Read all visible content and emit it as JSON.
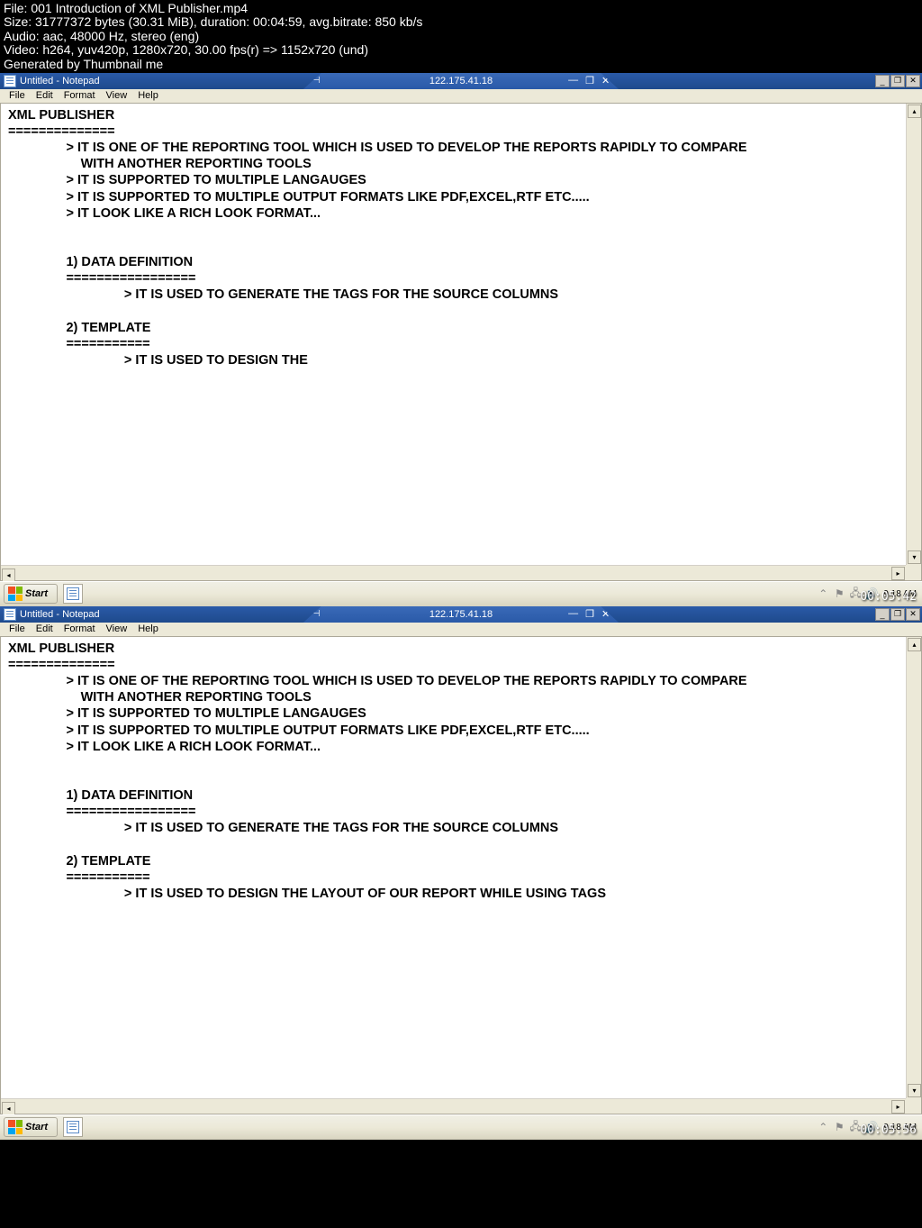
{
  "video_header": {
    "file": "File: 001 Introduction of XML Publisher.mp4",
    "size": "Size: 31777372 bytes (30.31 MiB), duration: 00:04:59, avg.bitrate: 850 kb/s",
    "audio": "Audio: aac, 48000 Hz, stereo (eng)",
    "video": "Video: h264, yuv420p, 1280x720, 30.00 fps(r) => 1152x720 (und)",
    "generated": "Generated by Thumbnail me"
  },
  "frame1": {
    "titlebar": {
      "title": "Untitled - Notepad",
      "remote_ip": "122.175.41.18"
    },
    "menu": [
      "File",
      "Edit",
      "Format",
      "View",
      "Help"
    ],
    "content": "XML PUBLISHER\n==============\n                > IT IS ONE OF THE REPORTING TOOL WHICH IS USED TO DEVELOP THE REPORTS RAPIDLY TO COMPARE\n                    WITH ANOTHER REPORTING TOOLS\n                > IT IS SUPPORTED TO MULTIPLE LANGAUGES\n                > IT IS SUPPORTED TO MULTIPLE OUTPUT FORMATS LIKE PDF,EXCEL,RTF ETC.....\n                > IT LOOK LIKE A RICH LOOK FORMAT...\n\n\n                1) DATA DEFINITION\n                =================\n                                > IT IS USED TO GENERATE THE TAGS FOR THE SOURCE COLUMNS\n\n                2) TEMPLATE\n                ===========\n                                > IT IS USED TO DESIGN THE",
    "taskbar": {
      "start": "Start",
      "clock_time": "9:18 AM"
    },
    "timestamp": "00:05:42"
  },
  "frame2": {
    "titlebar": {
      "title": "Untitled - Notepad",
      "remote_ip": "122.175.41.18"
    },
    "menu": [
      "File",
      "Edit",
      "Format",
      "View",
      "Help"
    ],
    "content": "XML PUBLISHER\n==============\n                > IT IS ONE OF THE REPORTING TOOL WHICH IS USED TO DEVELOP THE REPORTS RAPIDLY TO COMPARE\n                    WITH ANOTHER REPORTING TOOLS\n                > IT IS SUPPORTED TO MULTIPLE LANGAUGES\n                > IT IS SUPPORTED TO MULTIPLE OUTPUT FORMATS LIKE PDF,EXCEL,RTF ETC.....\n                > IT LOOK LIKE A RICH LOOK FORMAT...\n\n\n                1) DATA DEFINITION\n                =================\n                                > IT IS USED TO GENERATE THE TAGS FOR THE SOURCE COLUMNS\n\n                2) TEMPLATE\n                ===========\n                                > IT IS USED TO DESIGN THE LAYOUT OF OUR REPORT WHILE USING TAGS\n\n",
    "taskbar": {
      "start": "Start",
      "clock_time": "9:18 AM"
    },
    "timestamp": "00:05:56"
  }
}
